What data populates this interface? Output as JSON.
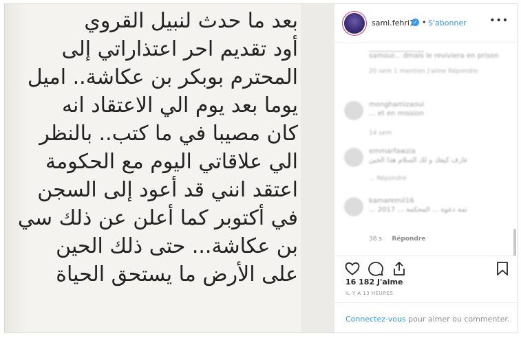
{
  "post": {
    "media_lines": [
      "بعد ما حدث لنبيل القروي",
      "أود تقديم احر اعتذاراتي إلى",
      "المحترم بوبكر بن عكاشة.. اميل",
      "يوما بعد يوم الي الاعتقاد انه",
      "كان مصيبا في ما كتب.. بالنظر",
      "الي علاقاتي اليوم مع الحكومة",
      "اعتقد انني قد أعود إلى السجن",
      "في أكتوبر كما أعلن عن ذلك سي",
      "بن عكاشة... حتى ذلك الحين",
      "على الأرض ما يستحق الحياة"
    ]
  },
  "header": {
    "username": "sami.fehri1",
    "verified_glyph": "✓",
    "separator": "•",
    "follow_label": "S'abonner",
    "more_glyph": "•••"
  },
  "comments": {
    "items": [
      {
        "user": "________________",
        "text": "samour... dmais le reviviera en prison",
        "meta": "20 sem   1 mention J'aime   Répondre"
      },
      {
        "user": "monghamizaoui",
        "text": "... et en mission",
        "meta": "14 sem"
      },
      {
        "user": "emmarfawzia",
        "text": "عارف كيفك و لك السلام هذا الحين",
        "meta": "... Répondre"
      },
      {
        "user": "kamaremil16",
        "text": "... ثمة دعوة ... المحكمة ... 2017",
        "meta": ""
      }
    ],
    "last_time": "38 s",
    "last_reply": "Répondre"
  },
  "actions": {
    "like_icon": "heart-icon",
    "comment_icon": "comment-icon",
    "share_icon": "share-icon",
    "save_icon": "bookmark-icon"
  },
  "likes": "16 182 J'aime",
  "timestamp": "IL Y A 13 HEURES",
  "login": {
    "link": "Connectez-vous",
    "text": " pour aimer ou commenter."
  },
  "colors": {
    "accent": "#3897f0",
    "border": "#dbdbdb",
    "muted": "#8e8e8e"
  }
}
